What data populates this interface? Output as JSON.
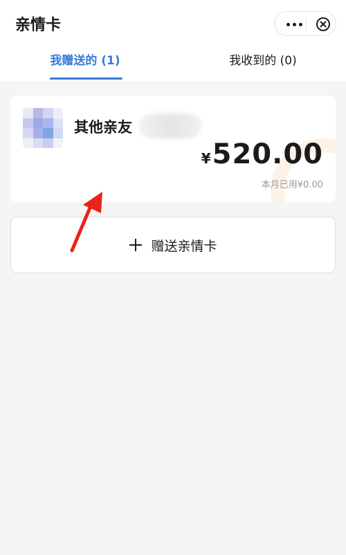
{
  "header": {
    "title": "亲情卡"
  },
  "tabs": [
    {
      "label": "我赠送的 (1)",
      "active": true
    },
    {
      "label": "我收到的 (0)",
      "active": false
    }
  ],
  "card": {
    "name": "其他亲友",
    "currency": "¥",
    "amount": "520.00",
    "used_text": "本月已用¥0.00"
  },
  "add_button": {
    "label": "赠送亲情卡"
  },
  "colors": {
    "accent": "#3a7bd5",
    "annotation_arrow": "#e8231a"
  }
}
